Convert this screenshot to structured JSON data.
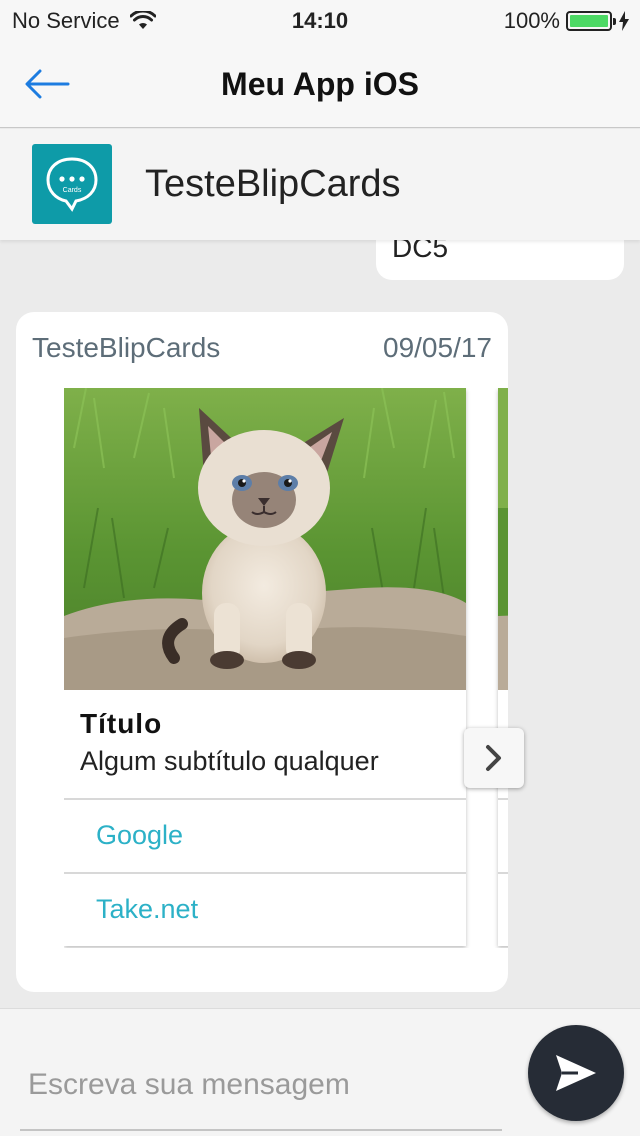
{
  "status_bar": {
    "carrier": "No Service",
    "time": "14:10",
    "battery": "100%",
    "battery_level": 1.0,
    "icons": [
      "wifi-icon",
      "battery-icon",
      "charging-bolt-icon"
    ]
  },
  "nav": {
    "title": "Meu App iOS",
    "back_icon": "back-arrow-icon"
  },
  "contact": {
    "name": "TesteBlipCards",
    "avatar_icon": "chat-bubble-cards-icon",
    "avatar_text": "Cards"
  },
  "previous_message": {
    "text": "DC5"
  },
  "message": {
    "sender": "TesteBlipCards",
    "date": "09/05/17",
    "cards": [
      {
        "image": "kitten-photo",
        "title": "Título",
        "subtitle": "Algum subtítulo qualquer",
        "buttons": [
          {
            "label": "Google"
          },
          {
            "label": "Take.net"
          }
        ]
      }
    ],
    "next_icon": "chevron-right-icon"
  },
  "composer": {
    "placeholder": "Escreva sua mensagem",
    "value": "",
    "send_icon": "send-icon"
  },
  "colors": {
    "accent": "#2cb1c7",
    "avatar_bg": "#0e9ba8",
    "send_button": "#262c36",
    "back_arrow": "#1d7ce0",
    "battery": "#4cd964"
  }
}
